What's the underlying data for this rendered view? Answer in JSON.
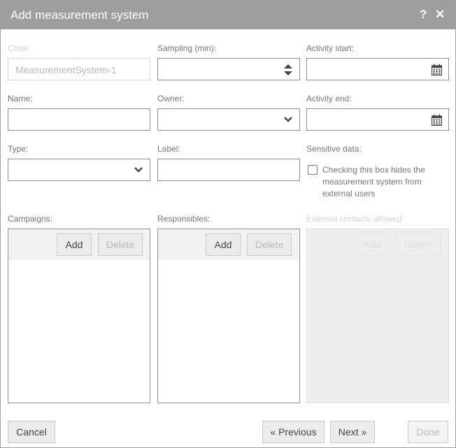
{
  "dialog": {
    "title": "Add measurement system",
    "help_glyph": "?",
    "close_glyph": "✕"
  },
  "form": {
    "code": {
      "label": "Code:",
      "value": "MeasurementSystem-1"
    },
    "sampling": {
      "label": "Sampling (min):",
      "value": ""
    },
    "activity_start": {
      "label": "Activity start:",
      "value": ""
    },
    "name": {
      "label": "Name:",
      "value": ""
    },
    "owner": {
      "label": "Owner:",
      "value": ""
    },
    "activity_end": {
      "label": "Activity end:",
      "value": ""
    },
    "type": {
      "label": "Type:",
      "value": ""
    },
    "label": {
      "label": "Label:",
      "value": ""
    },
    "sensitive": {
      "label": "Sensitive data:",
      "checked": false,
      "description": "Checking this box hides the measurement system from external users"
    }
  },
  "lists": {
    "campaigns": {
      "label": "Campaigns:",
      "add": "Add",
      "delete": "Delete"
    },
    "responsibles": {
      "label": "Responsibles:",
      "add": "Add",
      "delete": "Delete"
    },
    "external_contacts": {
      "label": "External contacts allowed:",
      "add": "Add",
      "delete": "Delete"
    }
  },
  "footer": {
    "cancel": "Cancel",
    "previous": "« Previous",
    "next": "Next »",
    "done": "Done"
  },
  "icons": {
    "spinner": "spinner-arrows-icon",
    "dropdown": "chevron-down-icon",
    "calendar": "calendar-icon",
    "help": "help-icon",
    "close": "close-icon"
  }
}
